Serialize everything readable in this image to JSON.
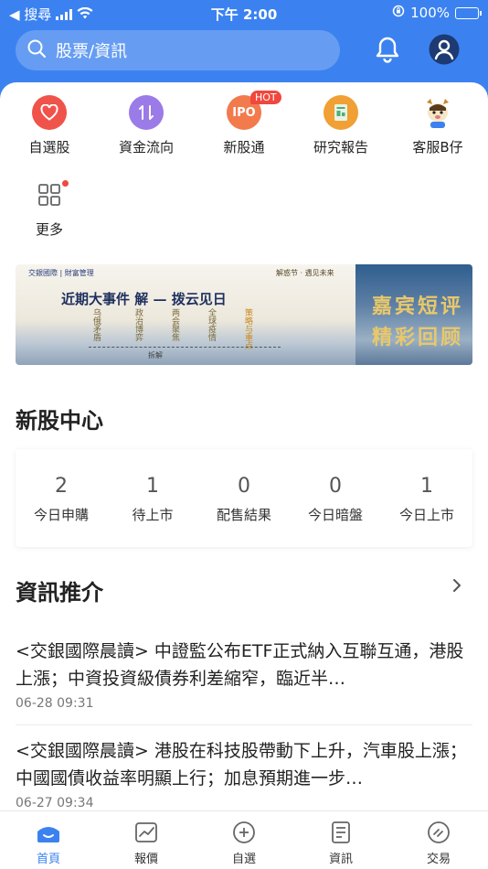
{
  "status_bar": {
    "back_app": "◀ 搜尋",
    "time": "下午 2:00",
    "battery": "100%"
  },
  "header": {
    "search_placeholder": "股票/資訊"
  },
  "quick_menu": [
    {
      "label": "自選股",
      "icon": "heart-icon",
      "color": "#f0534a"
    },
    {
      "label": "資金流向",
      "icon": "fund-flow-icon",
      "color": "#9b7be8"
    },
    {
      "label": "新股通",
      "icon": "ipo-icon",
      "icon_text": "IPO",
      "badge": "HOT",
      "color": "#f27a4d"
    },
    {
      "label": "研究報告",
      "icon": "report-icon",
      "color": "#f0a035"
    },
    {
      "label": "客服B仔",
      "icon": "mascot-icon",
      "color": "#ffffff"
    },
    {
      "label": "更多",
      "icon": "more-grid-icon",
      "color": "#ffffff"
    }
  ],
  "banner": {
    "brand": "交銀國際 | 財富管理",
    "brand_right": "解惑节 · 遇见未来",
    "title": "近期大事件",
    "title2": "解 — 拨云见日",
    "topics": [
      "乌俄矛盾",
      "政治博弈",
      "两会聚焦",
      "全球疫情",
      "策略与重点"
    ],
    "timeline": "拆解",
    "right_text_1": "嘉宾短评",
    "right_text_2": "精彩回顾"
  },
  "ipo_center": {
    "title": "新股中心",
    "items": [
      {
        "value": "2",
        "label": "今日申購"
      },
      {
        "value": "1",
        "label": "待上市"
      },
      {
        "value": "0",
        "label": "配售結果"
      },
      {
        "value": "0",
        "label": "今日暗盤"
      },
      {
        "value": "1",
        "label": "今日上市"
      }
    ]
  },
  "news_section": {
    "title": "資訊推介",
    "items": [
      {
        "title": "<交銀國際晨讀> 中證監公布ETF正式納入互聯互通，港股上漲；中資投資級債券利差縮窄，臨近半…",
        "time": "06-28 09:31"
      },
      {
        "title": "<交銀國際晨讀> 港股在科技股帶動下上升，汽車股上漲；中國國債收益率明顯上行；加息預期進一步…",
        "time": "06-27 09:34"
      }
    ]
  },
  "tabbar": [
    {
      "label": "首頁",
      "icon": "home-icon",
      "active": true
    },
    {
      "label": "報價",
      "icon": "quote-chart-icon",
      "active": false
    },
    {
      "label": "自選",
      "icon": "add-circle-icon",
      "active": false
    },
    {
      "label": "資訊",
      "icon": "news-doc-icon",
      "active": false
    },
    {
      "label": "交易",
      "icon": "trade-icon",
      "active": false
    }
  ],
  "colors": {
    "primary": "#3b82f0",
    "hot_badge": "#f0483e"
  }
}
